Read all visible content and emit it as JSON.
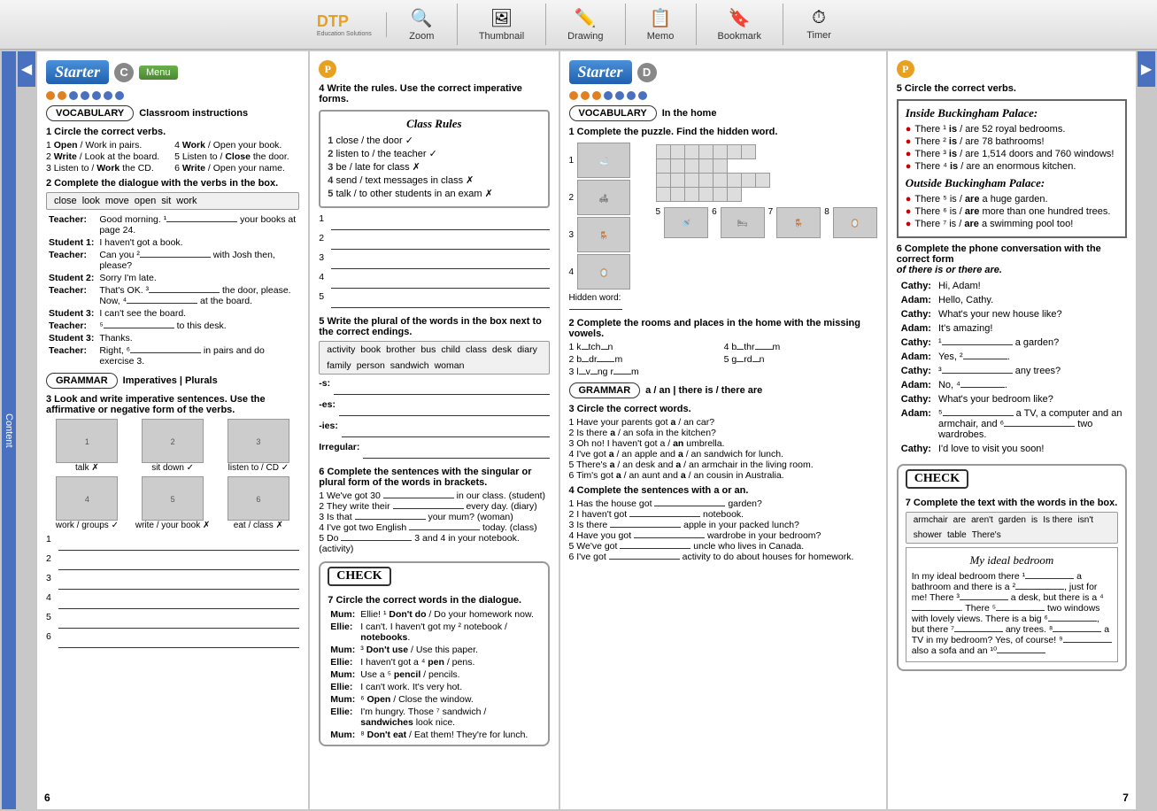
{
  "toolbar": {
    "logo": "DTP",
    "logo_sub": "Education Solutions",
    "buttons": [
      {
        "label": "Zoom",
        "icon": "🔍"
      },
      {
        "label": "Thumbnail",
        "icon": "🖼"
      },
      {
        "label": "Drawing",
        "icon": "✏️"
      },
      {
        "label": "Memo",
        "icon": "📋"
      },
      {
        "label": "Bookmark",
        "icon": "🔖"
      },
      {
        "label": "Timer",
        "icon": "⏱"
      }
    ]
  },
  "pageLeft": {
    "starter": "Starter",
    "letter": "C",
    "menu": "Menu",
    "vocabulary_label": "VOCABULARY",
    "vocabulary_title": "Classroom instructions",
    "q1_title": "1  Circle the correct verbs.",
    "q1_items": [
      "1  Open / Work in pairs.",
      "4  Work / Open your book.",
      "2  Write / Look at the board.",
      "5  Listen to / Close the door.",
      "3  Listen to / Work the CD.",
      "6  Write / Open your name."
    ],
    "q2_title": "2  Complete the dialogue with the verbs in the box.",
    "q2_words": [
      "close",
      "look",
      "move",
      "open",
      "sit",
      "work"
    ],
    "dialogue": [
      {
        "speaker": "Teacher:",
        "text": "Good morning. ¹____________ your books at page 24."
      },
      {
        "speaker": "Student 1:",
        "text": "I haven't got a book."
      },
      {
        "speaker": "Teacher:",
        "text": "Can you ²____________ with Josh then, please?"
      },
      {
        "speaker": "Student 2:",
        "text": "Sorry I'm late."
      },
      {
        "speaker": "Teacher:",
        "text": "That's OK. ³____________ the door, please. Now, ⁴____________ at the board."
      },
      {
        "speaker": "Student 3:",
        "text": "I can't see the board."
      },
      {
        "speaker": "Teacher:",
        "text": "⁵____________ to this desk."
      },
      {
        "speaker": "Student 3:",
        "text": "Thanks."
      },
      {
        "speaker": "Teacher:",
        "text": "Right, ⁶____________ in pairs and do exercise 3."
      }
    ],
    "grammar_label": "GRAMMAR",
    "grammar_title": "Imperatives | Plurals",
    "q3_title": "3  Look and write imperative sentences. Use the affirmative or negative form of the verbs.",
    "img_captions": [
      "talk ✗",
      "sit down ✓",
      "listen to CD ✓",
      "work / groups ✓",
      "write / your book ✗",
      "eat / class ✗"
    ],
    "fill_lines": 6,
    "page_num": "6"
  },
  "pageCenterLeft": {
    "p_badge": "P",
    "q4_title": "4  Write the rules. Use the correct imperative forms.",
    "rules_title": "Class Rules",
    "rules": [
      {
        "num": "1",
        "text": "close / the door ✓"
      },
      {
        "num": "2",
        "text": "listen to / the teacher ✓"
      },
      {
        "num": "3",
        "text": "be / late for class ✗"
      },
      {
        "num": "4",
        "text": "send / text messages in class ✗"
      },
      {
        "num": "5",
        "text": "talk / to other students in an exam ✗"
      }
    ],
    "fill_lines_4": 5,
    "q5_title": "5  Write the plural of the words in the box next to the correct endings.",
    "q5_words": [
      "activity",
      "book",
      "brother",
      "bus",
      "child",
      "class",
      "desk",
      "diary",
      "family",
      "person",
      "sandwich",
      "woman"
    ],
    "plural_endings": [
      "-s:",
      "-es:",
      "-ies:",
      "Irregular:"
    ],
    "q6_title": "6  Complete the sentences with the singular or plural form of the words in brackets.",
    "q6_items": [
      "1  We've got 30 ____________ in our class. (student)",
      "2  They write their ____________ every day. (diary)",
      "3  Is that ____________ your mum? (woman)",
      "4  I've got two English ____________ today. (class)",
      "5  Do ____________ 3 and 4 in your notebook. (activity)"
    ],
    "check_title": "CHECK",
    "q7_title": "7  Circle the correct words in the dialogue.",
    "check_dialogue": [
      {
        "speaker": "Mum:",
        "text": "Ellie! ¹ Don't do / Do your homework now."
      },
      {
        "speaker": "Ellie:",
        "text": "I can't. I haven't got my ² notebook / notebooks."
      },
      {
        "speaker": "Mum:",
        "text": "³ Don't use / Use this paper."
      },
      {
        "speaker": "Ellie:",
        "text": "I haven't got a ⁴ pen / pens."
      },
      {
        "speaker": "Mum:",
        "text": "Use a ⁵ pencil / pencils."
      },
      {
        "speaker": "Ellie:",
        "text": "I can't work. It's very hot."
      },
      {
        "speaker": "Mum:",
        "text": "⁶ Open / Close the window."
      },
      {
        "speaker": "Ellie:",
        "text": "I'm hungry. Those ⁷ sandwich / sandwiches look nice."
      },
      {
        "speaker": "Mum:",
        "text": "⁸ Don't eat / Eat them! They're for lunch."
      }
    ]
  },
  "pageCenterRight": {
    "starter": "Starter",
    "letter": "D",
    "vocabulary_label": "VOCABULARY",
    "vocabulary_title": "In the home",
    "q1_title": "1  Complete the puzzle. Find the hidden word.",
    "q2_title": "2  Complete the rooms and places in the home with the missing vowels.",
    "q2_items": [
      {
        "a": "1  k__tch__n",
        "b": "4  b__thr___m"
      },
      {
        "a": "2  b__dr___m",
        "b": "5  g__rd__n"
      },
      {
        "a": "3  l__v__ng r___m",
        "b": ""
      }
    ],
    "grammar_label": "GRAMMAR",
    "grammar_title": "a / an | there is / there are",
    "q3_title": "3  Circle the correct words.",
    "q3_items": [
      "1  Have your parents got a / an car?",
      "2  Is there a / an sofa in the kitchen?",
      "3  Oh no! I haven't got a / an umbrella.",
      "4  I've got a / an apple and a / an sandwich for lunch.",
      "5  There's a / an desk and a / an armchair in the living room.",
      "6  Tim's got a / an aunt and a / an cousin in Australia."
    ],
    "q4_title": "4  Complete the sentences with a or an.",
    "q4_items": [
      "1  Has the house got ________ garden?",
      "2  I haven't got ________ notebook.",
      "3  Is there ________ apple in your packed lunch?",
      "4  Have you got ________ wardrobe in your bedroom?",
      "5  We've got ________ uncle who lives in Canada.",
      "6  I've got ________ activity to do about houses for homework."
    ]
  },
  "pageRight": {
    "p_badge": "P",
    "q5_title": "5  Circle the correct verbs.",
    "buckingham_title": "Inside Buckingham Palace:",
    "buck_inside": [
      "There ¹ is / are 52 royal bedrooms.",
      "There ² is / are 78 bathrooms!",
      "There ³ is / are 1,514 doors and 760 windows!",
      "There ⁴ is / are an enormous kitchen."
    ],
    "buckingham_outside": "Outside Buckingham Palace:",
    "buck_outside": [
      "There ⁵ is / are a huge garden.",
      "There ⁶ is / are more than one hundred trees.",
      "There ⁷ is / are a swimming pool too!"
    ],
    "q6_title": "6  Complete the phone conversation with the correct form of there is or there are.",
    "q6_subtitle": "of there is or there are.",
    "phone_conv": [
      {
        "speaker": "Cathy:",
        "text": "Hi, Adam!"
      },
      {
        "speaker": "Adam:",
        "text": "Hello, Cathy."
      },
      {
        "speaker": "Cathy:",
        "text": "What's your new house like?"
      },
      {
        "speaker": "Adam:",
        "text": "It's amazing!"
      },
      {
        "speaker": "Cathy:",
        "text": "¹____________ a garden?"
      },
      {
        "speaker": "Adam:",
        "text": "Yes, ²____________."
      },
      {
        "speaker": "Cathy:",
        "text": "³____________ any trees?"
      },
      {
        "speaker": "Adam:",
        "text": "No, ⁴____________."
      },
      {
        "speaker": "Cathy:",
        "text": "What's your bedroom like?"
      },
      {
        "speaker": "Adam:",
        "text": "⁵____________ a TV, a computer and an armchair, and ⁶____________ two wardrobes."
      },
      {
        "speaker": "Cathy:",
        "text": "I'd love to visit you soon!"
      }
    ],
    "check_title": "CHECK",
    "q7_title": "7  Complete the text with the words in the box.",
    "word_box_right": [
      "armchair",
      "are",
      "aren't",
      "garden",
      "is",
      "Is there",
      "isn't",
      "shower",
      "table",
      "There's"
    ],
    "bedroom_title": "My ideal bedroom",
    "bedroom_text": "In my ideal bedroom there ¹____________ a bathroom and there is a ²____________, just for me! There ³____________ a desk, but there is a ⁴____________. There ⁵____________ two windows with lovely views. There is a big ⁶____________, but there ⁷____________ any trees. ⁸____________ a TV in my bedroom? Yes, of course! ⁹____________ also a sofa and an ¹⁰____________",
    "page_num": "7"
  }
}
